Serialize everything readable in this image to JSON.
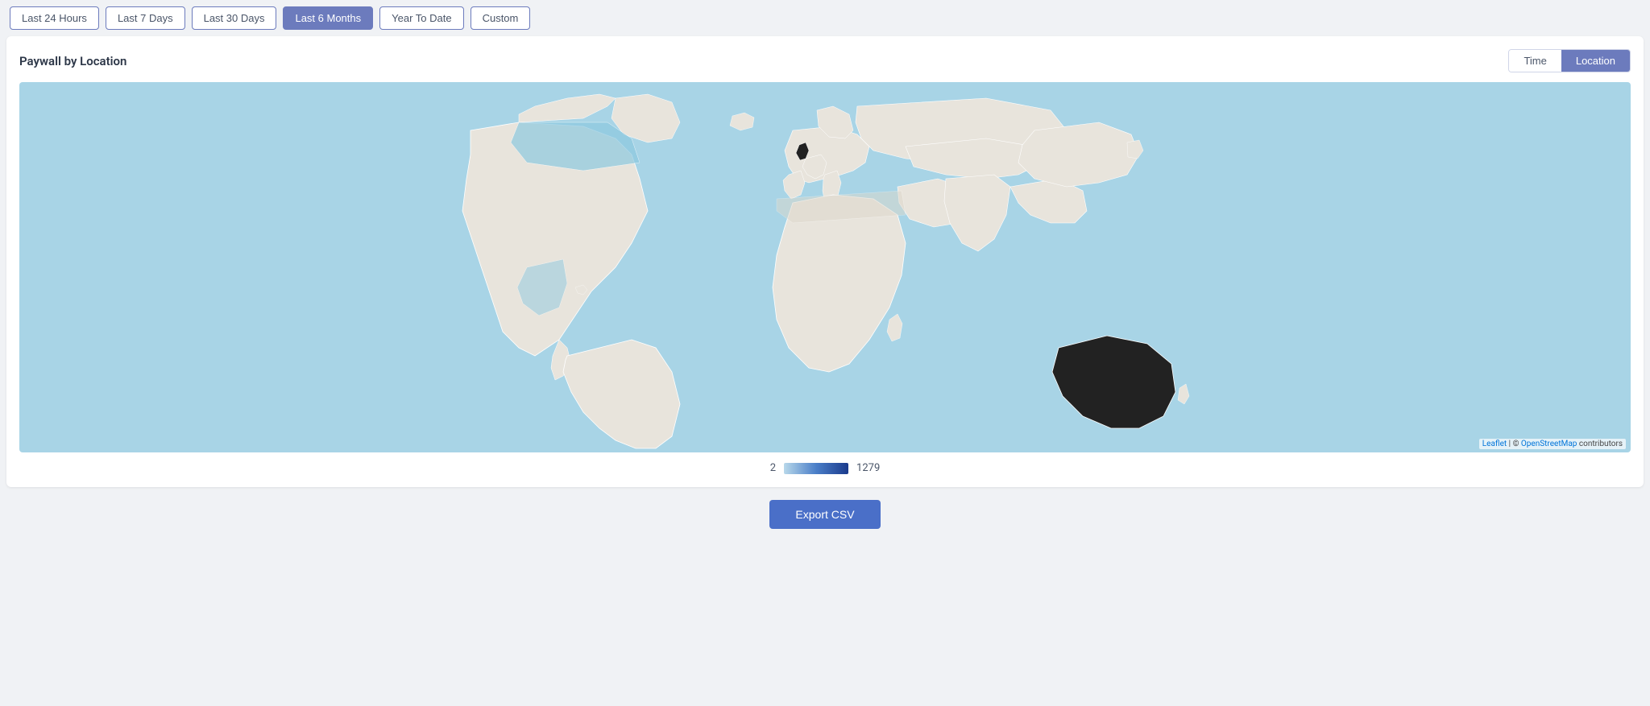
{
  "filterBar": {
    "buttons": [
      {
        "id": "last24h",
        "label": "Last 24 Hours",
        "active": false
      },
      {
        "id": "last7d",
        "label": "Last 7 Days",
        "active": false
      },
      {
        "id": "last30d",
        "label": "Last 30 Days",
        "active": false
      },
      {
        "id": "last6m",
        "label": "Last 6 Months",
        "active": true
      },
      {
        "id": "ytd",
        "label": "Year To Date",
        "active": false
      },
      {
        "id": "custom",
        "label": "Custom",
        "active": false
      }
    ]
  },
  "card": {
    "title": "Paywall by Location",
    "viewToggle": {
      "time": "Time",
      "location": "Location",
      "active": "location"
    }
  },
  "legend": {
    "min": "2",
    "max": "1279"
  },
  "exportButton": "Export CSV",
  "attribution": {
    "leaflet": "Leaflet",
    "osm": "OpenStreetMap",
    "suffix": " contributors"
  }
}
